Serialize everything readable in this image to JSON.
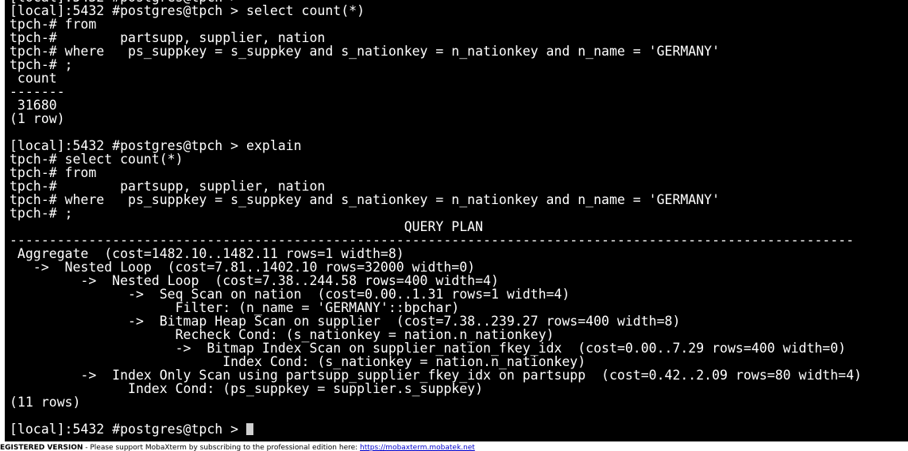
{
  "terminal": {
    "lines": [
      "[local]:5432 #postgres@tpch >",
      "[local]:5432 #postgres@tpch > select count(*)",
      "tpch-# from",
      "tpch-#        partsupp, supplier, nation",
      "tpch-# where   ps_suppkey = s_suppkey and s_nationkey = n_nationkey and n_name = 'GERMANY'",
      "tpch-# ;",
      " count",
      "-------",
      " 31680",
      "(1 row)",
      "",
      "[local]:5432 #postgres@tpch > explain",
      "tpch-# select count(*)",
      "tpch-# from",
      "tpch-#        partsupp, supplier, nation",
      "tpch-# where   ps_suppkey = s_suppkey and s_nationkey = n_nationkey and n_name = 'GERMANY'",
      "tpch-# ;",
      "                                                  QUERY PLAN",
      "-----------------------------------------------------------------------------------------------------------",
      " Aggregate  (cost=1482.10..1482.11 rows=1 width=8)",
      "   ->  Nested Loop  (cost=7.81..1402.10 rows=32000 width=0)",
      "         ->  Nested Loop  (cost=7.38..244.58 rows=400 width=4)",
      "               ->  Seq Scan on nation  (cost=0.00..1.31 rows=1 width=4)",
      "                     Filter: (n_name = 'GERMANY'::bpchar)",
      "               ->  Bitmap Heap Scan on supplier  (cost=7.38..239.27 rows=400 width=8)",
      "                     Recheck Cond: (s_nationkey = nation.n_nationkey)",
      "                     ->  Bitmap Index Scan on supplier_nation_fkey_idx  (cost=0.00..7.29 rows=400 width=0)",
      "                           Index Cond: (s_nationkey = nation.n_nationkey)",
      "         ->  Index Only Scan using partsupp_supplier_fkey_idx on partsupp  (cost=0.42..2.09 rows=80 width=4)",
      "               Index Cond: (ps_suppkey = supplier.s_suppkey)",
      "(11 rows)",
      ""
    ],
    "prompt": "[local]:5432 #postgres@tpch > "
  },
  "status_bar": {
    "label": "EGISTERED VERSION",
    "message": " -  Please support MobaXterm by subscribing to the professional edition here: ",
    "link": "https://mobaxterm.mobatek.net"
  },
  "colors": {
    "terminal_bg": "#000000",
    "terminal_fg": "#ffffff",
    "link": "#0000cc"
  }
}
